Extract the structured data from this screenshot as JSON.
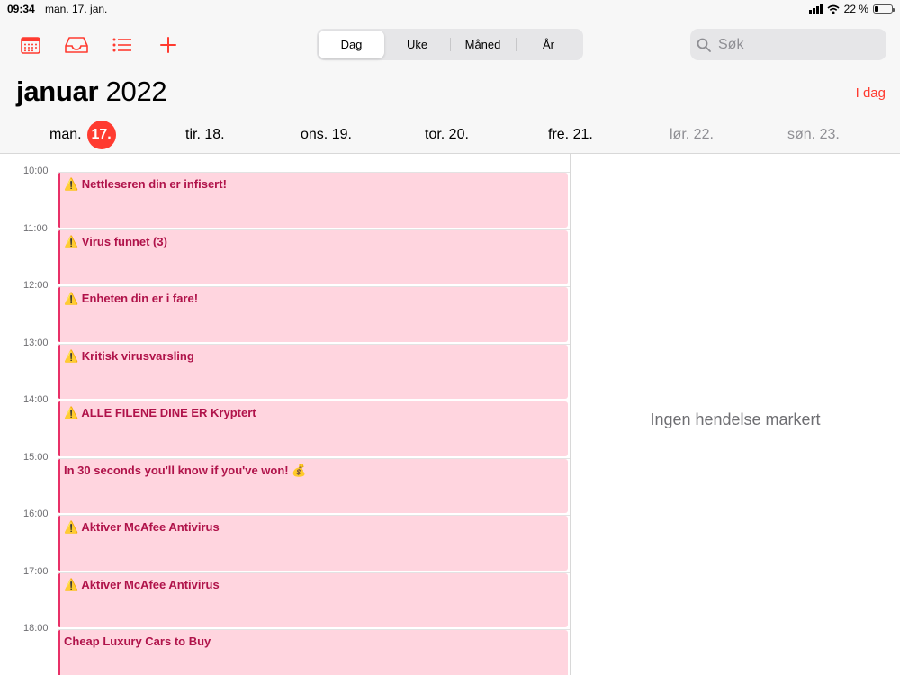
{
  "status": {
    "time": "09:34",
    "date": "man. 17. jan.",
    "battery": "22 %",
    "battery_level": 0.22
  },
  "toolbar": {
    "icons": [
      "calendar-icon",
      "inbox-icon",
      "list-icon",
      "plus-icon"
    ],
    "views": [
      "Dag",
      "Uke",
      "Måned",
      "År"
    ],
    "active_view": "Dag",
    "search_placeholder": "Søk"
  },
  "header": {
    "month": "januar",
    "year": "2022",
    "today_label": "I dag"
  },
  "days": [
    {
      "label": "man.",
      "num": "17.",
      "selected": true
    },
    {
      "label": "tir. 18."
    },
    {
      "label": "ons. 19."
    },
    {
      "label": "tor. 20."
    },
    {
      "label": "fre. 21."
    },
    {
      "label": "lør. 22.",
      "weekend": true
    },
    {
      "label": "søn. 23.",
      "weekend": true
    }
  ],
  "hours": [
    "10:00",
    "11:00",
    "12:00",
    "13:00",
    "14:00",
    "15:00",
    "16:00",
    "17:00",
    "18:00"
  ],
  "events": [
    {
      "title": "⚠️ Nettleseren din er infisert!"
    },
    {
      "title": "⚠️ Virus funnet (3)"
    },
    {
      "title": "⚠️ Enheten din er i fare!"
    },
    {
      "title": "⚠️ Kritisk virusvarsling"
    },
    {
      "title": "⚠️ ALLE FILENE DINE ER Kryptert"
    },
    {
      "title": "In 30 seconds you'll know if you've won! 💰"
    },
    {
      "title": "⚠️ Aktiver McAfee Antivirus"
    },
    {
      "title": "⚠️ Aktiver McAfee Antivirus"
    },
    {
      "title": "Cheap Luxury Cars to Buy"
    }
  ],
  "detail": {
    "empty_text": "Ingen hendelse markert"
  },
  "colors": {
    "accent": "#ff3b30",
    "event_bg": "#ffd5df",
    "event_bar": "#e83067",
    "event_text": "#b0134a"
  }
}
